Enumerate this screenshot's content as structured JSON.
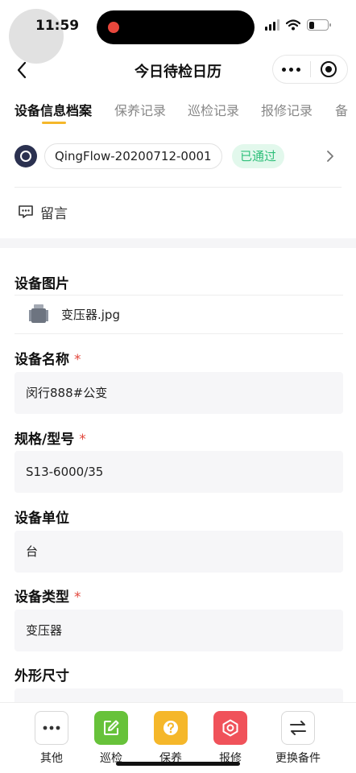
{
  "status_bar": {
    "time": "11:59"
  },
  "nav": {
    "title": "今日待检日历"
  },
  "tabs": [
    "设备信息档案",
    "保养记录",
    "巡检记录",
    "报修记录",
    "备"
  ],
  "record": {
    "id": "QingFlow-20200712-0001",
    "status": "已通过"
  },
  "comment": {
    "label": "留言"
  },
  "fields": {
    "image": {
      "label": "设备图片",
      "file_name": "变压器.jpg"
    },
    "name": {
      "label": "设备名称",
      "required": "*",
      "value": "闵行888#公变"
    },
    "model": {
      "label": "规格/型号",
      "required": "*",
      "value": "S13-6000/35"
    },
    "unit": {
      "label": "设备单位",
      "value": "台"
    },
    "type": {
      "label": "设备类型",
      "required": "*",
      "value": "变压器"
    },
    "size": {
      "label": "外形尺寸",
      "value": ""
    }
  },
  "toolbar": [
    {
      "label": "其他",
      "icon": "more-icon",
      "color": "#ffffff"
    },
    {
      "label": "巡检",
      "icon": "edit-icon",
      "color": "#67c23a"
    },
    {
      "label": "保养",
      "icon": "question-icon",
      "color": "#f5b72a"
    },
    {
      "label": "报修",
      "icon": "wrench-icon",
      "color": "#f0525a"
    },
    {
      "label": "更换备件",
      "icon": "swap-icon",
      "color": "#ffffff"
    }
  ]
}
